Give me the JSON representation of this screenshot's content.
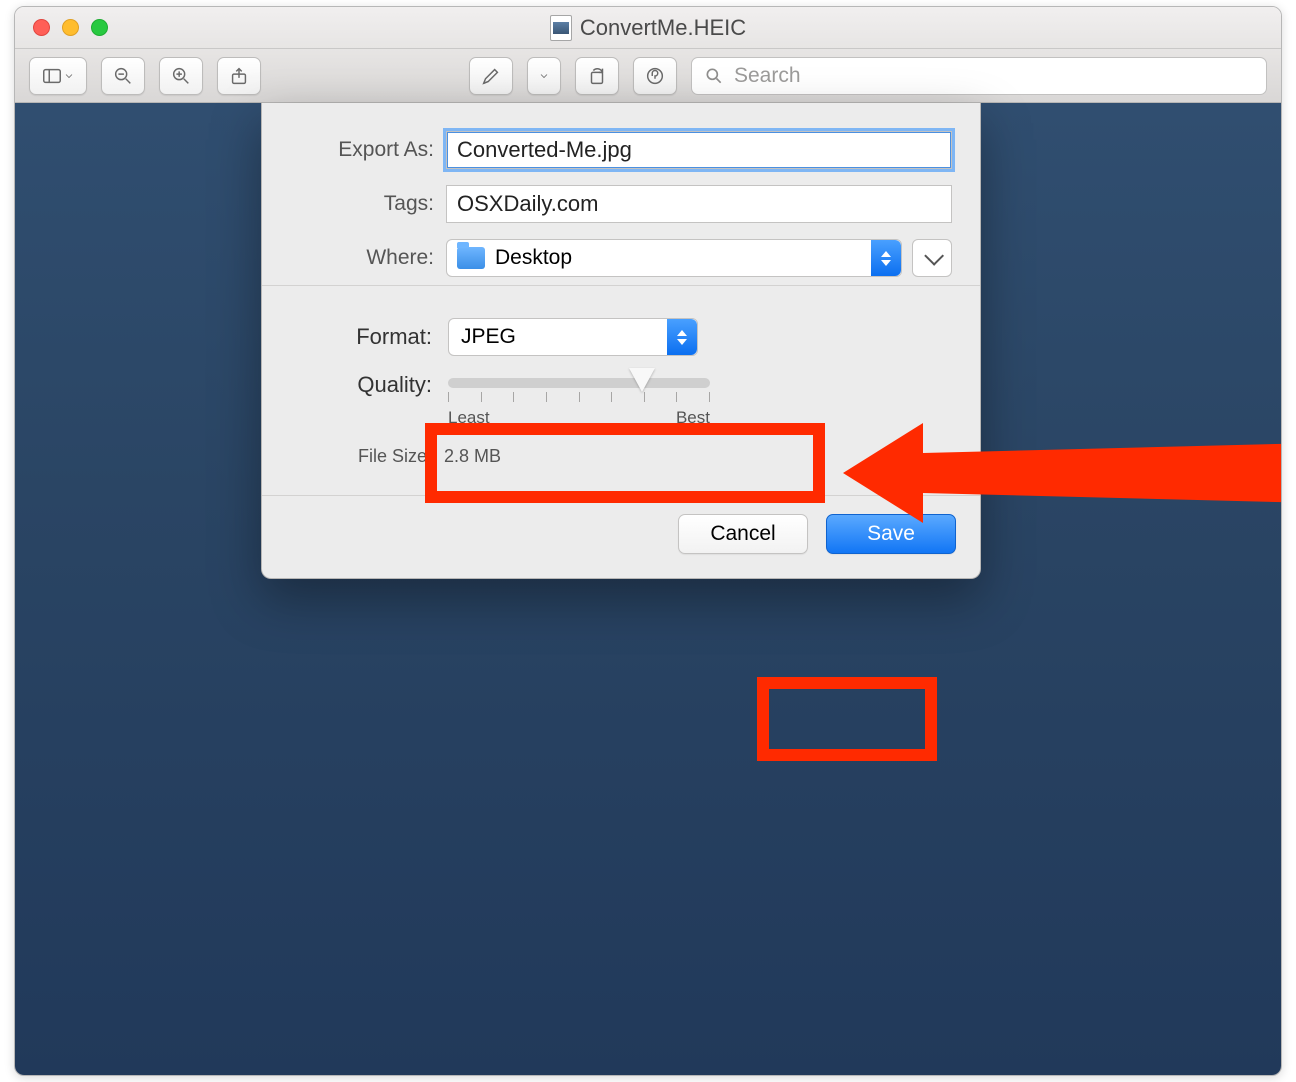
{
  "window": {
    "title": "ConvertMe.HEIC"
  },
  "toolbar": {
    "search_placeholder": "Search"
  },
  "export": {
    "export_as_label": "Export As:",
    "filename": "Converted-Me.jpg",
    "tags_label": "Tags:",
    "tags_value": "OSXDaily.com",
    "where_label": "Where:",
    "where_value": "Desktop",
    "format_label": "Format:",
    "format_value": "JPEG",
    "quality_label": "Quality:",
    "quality_least": "Least",
    "quality_best": "Best",
    "filesize_label": "File Size:",
    "filesize_value": "2.8 MB",
    "cancel_label": "Cancel",
    "save_label": "Save"
  }
}
